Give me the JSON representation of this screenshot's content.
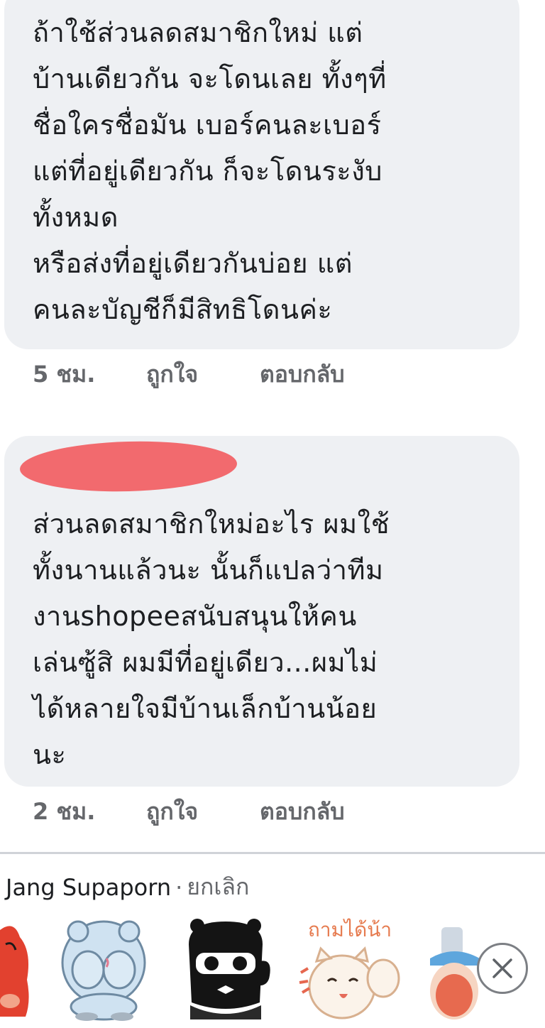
{
  "comments": [
    {
      "text": "ถ้าใช้ส่วนลดสมาชิกใหม่ แต่\nบ้านเดียวกัน จะโดนเลย ทั้งๆที่\nชื่อใครชื่อมัน เบอร์คนละเบอร์\nแต่ที่อยู่เดียวกัน ก็จะโดนระงับ\nทั้งหมด\nหรือส่งที่อยู่เดียวกันบ่อย แต่\nคนละบัญชีก็มีสิทธิโดนค่ะ",
      "time": "5 ชม.",
      "like_label": "ถูกใจ",
      "reply_label": "ตอบกลับ"
    },
    {
      "text": "ส่วนลดสมาชิกใหม่อะไร ผมใช้\nทั้งนานแล้วนะ นั้นก็แปลว่าทีม\nงานshopeeสนับสนุนให้คน\nเล่นซู้สิ ผมมีที่อยู่เดียว...ผมไม่\nได้หลายใจมีบ้านเล็กบ้านน้อย\nนะ",
      "time": "2 ชม.",
      "like_label": "ถูกใจ",
      "reply_label": "ตอบกลับ"
    }
  ],
  "reply_bar": {
    "name": "Jang Supaporn",
    "separator": "·",
    "cancel_label": "ยกเลิก"
  },
  "stickers": [
    {
      "name": "red-bird-sticker"
    },
    {
      "name": "blue-bear-sticker"
    },
    {
      "name": "black-cat-thumbs-up-sticker",
      "caption": ""
    },
    {
      "name": "cat-waving-sticker",
      "caption": "ถามได้น้า"
    },
    {
      "name": "penguin-sticker"
    }
  ],
  "colors": {
    "bubble_bg": "#eef0f3",
    "meta_text": "#65676b",
    "redaction": "#f26a6e"
  }
}
